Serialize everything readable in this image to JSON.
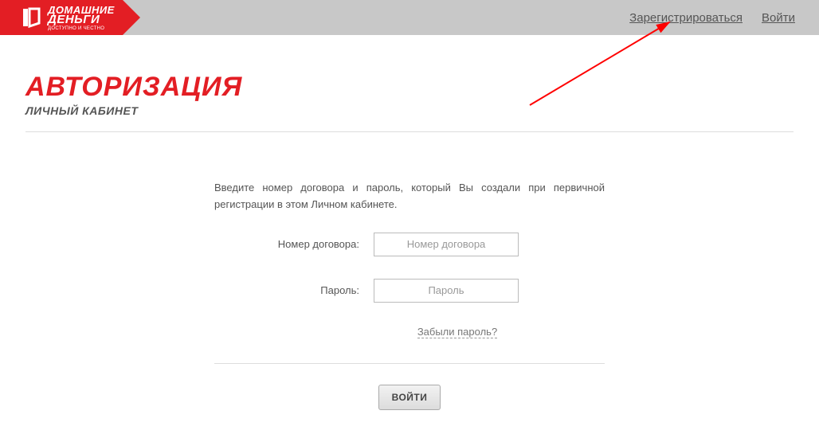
{
  "brand": {
    "line1": "ДОМАШНИЕ",
    "line2": "ДЕНЬГИ",
    "sub": "ДОСТУПНО И ЧЕСТНО"
  },
  "header": {
    "register": "Зарегистрироваться",
    "login": "Войти"
  },
  "page": {
    "title": "АВТОРИЗАЦИЯ",
    "subtitle": "ЛИЧНЫЙ КАБИНЕТ"
  },
  "form": {
    "intro": "Введите номер договора и пароль, который Вы создали при первичной регистрации в этом Личном кабинете.",
    "contract_label": "Номер договора:",
    "contract_placeholder": "Номер договора",
    "password_label": "Пароль:",
    "password_placeholder": "Пароль",
    "forgot": "Забыли пароль?",
    "submit": "ВОЙТИ"
  },
  "colors": {
    "brand_red": "#e31e24",
    "header_gray": "#c8c8c8"
  }
}
